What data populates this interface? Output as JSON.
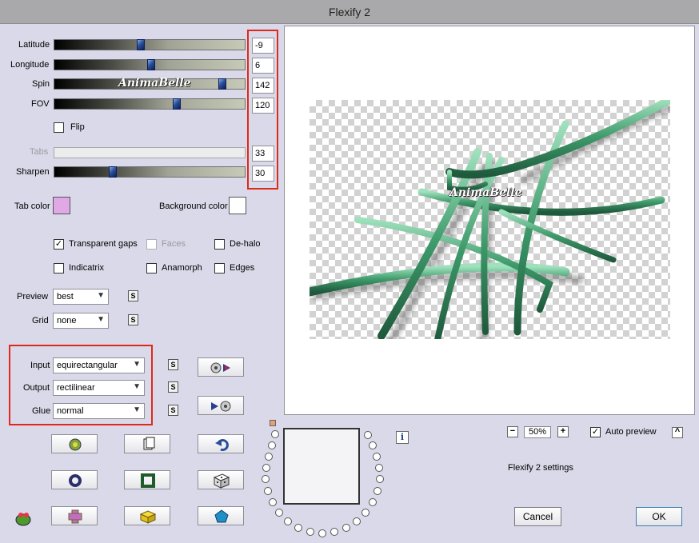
{
  "window": {
    "title": "Flexify 2"
  },
  "params": {
    "latitude": {
      "label": "Latitude",
      "value": "-9",
      "pos": 0.45
    },
    "longitude": {
      "label": "Longitude",
      "value": "6",
      "pos": 0.51
    },
    "spin": {
      "label": "Spin",
      "value": "142",
      "pos": 0.9
    },
    "fov": {
      "label": "FOV",
      "value": "120",
      "pos": 0.65
    },
    "tabs": {
      "label": "Tabs",
      "value": "33"
    },
    "sharpen": {
      "label": "Sharpen",
      "value": "30",
      "pos": 0.3
    }
  },
  "flip": {
    "label": "Flip",
    "checked": false
  },
  "colors": {
    "tab_color_label": "Tab color",
    "tab_color": "#e0a9e6",
    "background_color_label": "Background color",
    "background_color": "#ffffff",
    "highlight": "#e0291a"
  },
  "options": {
    "transparent_gaps": {
      "label": "Transparent gaps",
      "checked": true
    },
    "faces": {
      "label": "Faces",
      "checked": false
    },
    "de_halo": {
      "label": "De-halo",
      "checked": false
    },
    "indicatrix": {
      "label": "Indicatrix",
      "checked": false
    },
    "anamorph": {
      "label": "Anamorph",
      "checked": false
    },
    "edges": {
      "label": "Edges",
      "checked": false
    }
  },
  "preview_settings": {
    "preview_label": "Preview",
    "preview_value": "best",
    "grid_label": "Grid",
    "grid_value": "none"
  },
  "projection": {
    "input_label": "Input",
    "input_value": "equirectangular",
    "output_label": "Output",
    "output_value": "rectilinear",
    "glue_label": "Glue",
    "glue_value": "normal"
  },
  "small_buttons": {
    "s": "S",
    "info": "i"
  },
  "watermark": "AnimaBelle",
  "zoom": {
    "minus": "−",
    "value": "50%",
    "plus": "+"
  },
  "auto_preview": {
    "label": "Auto preview",
    "checked": true,
    "collapse": "^"
  },
  "settings_name": "Flexify 2 settings",
  "buttons": {
    "cancel": "Cancel",
    "ok": "OK"
  },
  "icons": {
    "toolbar": [
      "randomize-icon",
      "copy-icon",
      "undo-icon",
      "ring-icon",
      "frame-icon",
      "dice-icon",
      "cross-icon",
      "cube-icon",
      "pentagon-icon"
    ],
    "app": "frog-icon",
    "preview_left": "film-reel-arrow-icon",
    "preview_right": "arrow-film-reel-icon"
  },
  "checkmark": "✓"
}
